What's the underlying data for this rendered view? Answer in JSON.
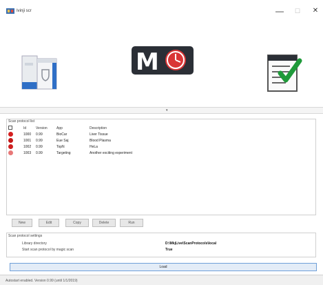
{
  "window": {
    "title": "Ivinji scr",
    "minimize_glyph": "—",
    "maximize_glyph": "☐",
    "close_glyph": "✕"
  },
  "hero": {
    "left_icon": "device-icon",
    "center_logo_letter": "M",
    "center_icon": "clock-icon",
    "right_icon": "checklist-icon"
  },
  "splitter": {
    "glyph": "▾"
  },
  "protocol_list": {
    "title": "Scan protocol list",
    "columns": [
      "",
      "Id",
      "Version",
      "App",
      "Description"
    ],
    "rows": [
      {
        "status_color": "#d42020",
        "id": "1000",
        "version": "0.99",
        "app": "BioCar",
        "description": "Liver Tissue"
      },
      {
        "status_color": "#c41818",
        "id": "1001",
        "version": "0.99",
        "app": "Eue Saj",
        "description": "Blood Plasma"
      },
      {
        "status_color": "#cf2020",
        "id": "1002",
        "version": "0.99",
        "app": "TopN",
        "description": "HeLa"
      },
      {
        "status_color": "#e87878",
        "id": "1003",
        "version": "0.99",
        "app": "Targeting",
        "description": "Another exciting experiment"
      }
    ]
  },
  "buttons": {
    "new": "New",
    "edit": "Edit",
    "copy": "Copy",
    "delete": "Delete",
    "run": "Run"
  },
  "settings": {
    "title": "Scan protocol settings",
    "rows": [
      {
        "label": "Library directory",
        "value": "D:\\MkjLive\\ScanProtocols\\local"
      },
      {
        "label": "Start scan protocol by magic scan",
        "value": "True"
      }
    ]
  },
  "load_button": "Load",
  "status_bar": "Autostart enabled. Version 0.99 (until 1/1/2019)",
  "colors": {
    "accent": "#6f9fd8",
    "logo_dark": "#2b2f36",
    "logo_red": "#d93636",
    "check_green": "#1f9a3a"
  }
}
